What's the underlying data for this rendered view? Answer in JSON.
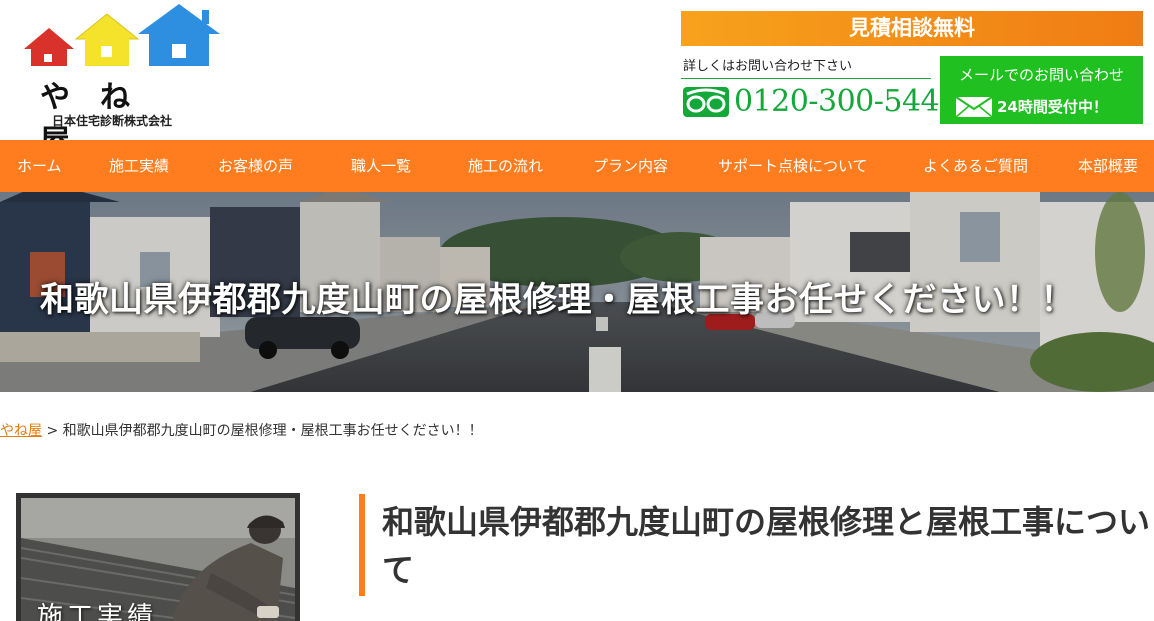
{
  "header": {
    "logo_name": "やね屋",
    "company": "日本住宅診断株式会社",
    "estimate_banner": "見積相談無料",
    "contact_note": "詳しくはお問い合わせ下さい",
    "phone_number": "0120-300-544",
    "mail_title": "メールでのお問い合わせ",
    "mail_hours": "24時間受付中！",
    "colors": {
      "accent": "#ff7d1e",
      "phone_green": "#14a83a",
      "mail_green": "#20c020"
    }
  },
  "nav": {
    "items": [
      "ホーム",
      "施工実績",
      "お客様の声",
      "職人一覧",
      "施工の流れ",
      "プラン内容",
      "サポート点検について",
      "よくあるご質問",
      "本部概要"
    ]
  },
  "hero": {
    "title": "和歌山県伊都郡九度山町の屋根修理・屋根工事お任せください！！"
  },
  "breadcrumb": {
    "home": "やね屋",
    "separator": " > ",
    "current": "和歌山県伊都郡九度山町の屋根修理・屋根工事お任せください！！"
  },
  "sidebar": {
    "card_label": "施工実績"
  },
  "main": {
    "heading": "和歌山県伊都郡九度山町の屋根修理と屋根工事について"
  },
  "icons": {
    "logo": "three-houses-icon",
    "freedial": "freedial-icon",
    "mail": "envelope-icon"
  }
}
